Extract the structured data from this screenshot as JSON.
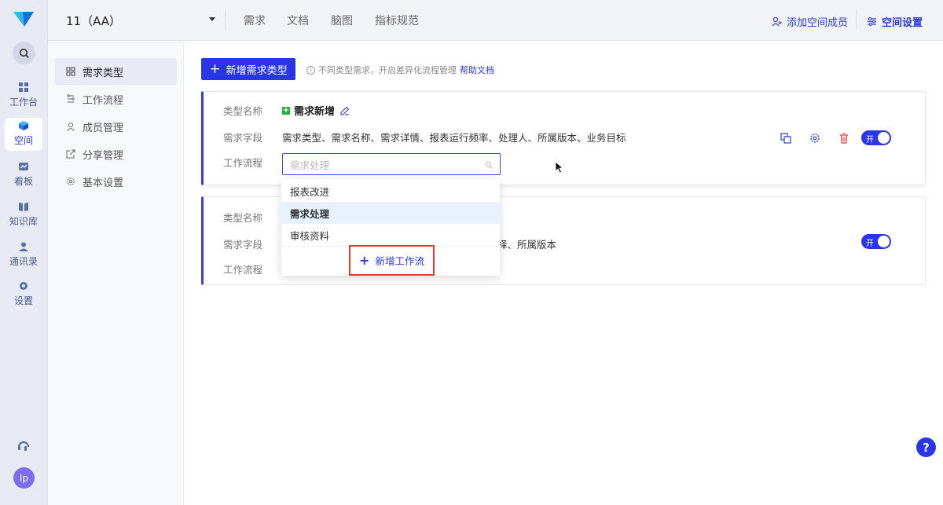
{
  "rail": {
    "items": [
      {
        "label": "工作台",
        "icon": "grid-icon"
      },
      {
        "label": "空间",
        "icon": "cube-icon"
      },
      {
        "label": "看板",
        "icon": "board-icon"
      },
      {
        "label": "知识库",
        "icon": "book-icon"
      },
      {
        "label": "通讯录",
        "icon": "contacts-icon"
      },
      {
        "label": "设置",
        "icon": "gear-icon"
      }
    ],
    "active": "空间",
    "avatar": "lp"
  },
  "topbar": {
    "space_name": "11（AA）",
    "tabs": [
      "需求",
      "文档",
      "脑图",
      "指标规范"
    ],
    "add_member": "添加空间成员",
    "space_settings": "空间设置"
  },
  "subnav": {
    "items": [
      {
        "label": "需求类型",
        "icon": "grid-icon"
      },
      {
        "label": "工作流程",
        "icon": "flow-icon"
      },
      {
        "label": "成员管理",
        "icon": "user-icon"
      },
      {
        "label": "分享管理",
        "icon": "share-icon"
      },
      {
        "label": "基本设置",
        "icon": "gear-icon"
      }
    ],
    "active": "需求类型"
  },
  "main": {
    "add_button": "新增需求类型",
    "hint": "不同类型需求，开启差异化流程管理",
    "help_link": "帮助文档",
    "labels": {
      "type_name": "类型名称",
      "fields": "需求字段",
      "workflow": "工作流程"
    },
    "card1": {
      "type_name": "需求新增",
      "fields": "需求类型、需求名称、需求详情、报表运行频率、处理人、所属版本、业务目标",
      "workflow_placeholder": "需求处理",
      "toggle": "开"
    },
    "card2": {
      "fields_tail": "择、所属版本",
      "toggle": "开"
    }
  },
  "dropdown": {
    "options": [
      "报表改进",
      "需求处理",
      "审核资料"
    ],
    "selected": "需求处理",
    "add_label": "新增工作流"
  },
  "colors": {
    "accent": "#2a35e8",
    "highlight_border": "#e03c31",
    "green": "#1db33a",
    "delete": "#e53935"
  }
}
